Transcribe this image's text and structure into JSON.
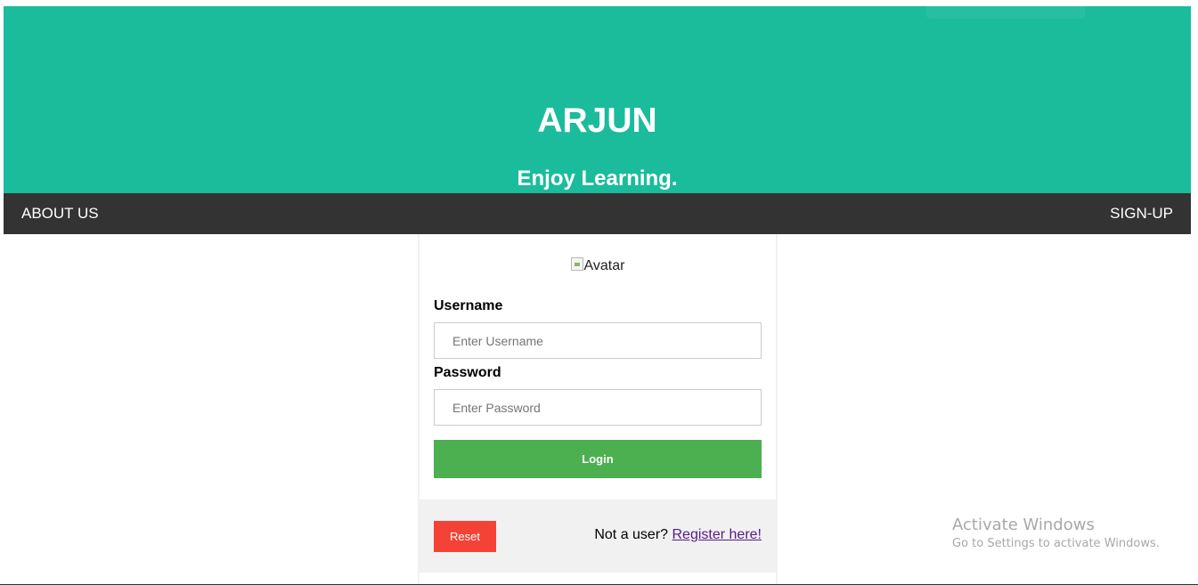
{
  "header": {
    "title": "ARJUN",
    "subtitle": "Enjoy Learning."
  },
  "nav": {
    "left_link": "ABOUT US",
    "right_link": "SIGN-UP"
  },
  "login": {
    "avatar_alt": "Avatar",
    "username_label": "Username",
    "username_placeholder": "Enter Username",
    "password_label": "Password",
    "password_placeholder": "Enter Password",
    "login_button": "Login",
    "reset_button": "Reset",
    "register_prompt": "Not a user? ",
    "register_link": "Register here!"
  },
  "watermark": {
    "title": "Activate Windows",
    "subtitle": "Go to Settings to activate Windows."
  },
  "colors": {
    "header_bg": "#1abc9c",
    "nav_bg": "#333333",
    "login_button": "#4caf50",
    "reset_button": "#f44336",
    "footer_bg": "#f1f1f1"
  }
}
